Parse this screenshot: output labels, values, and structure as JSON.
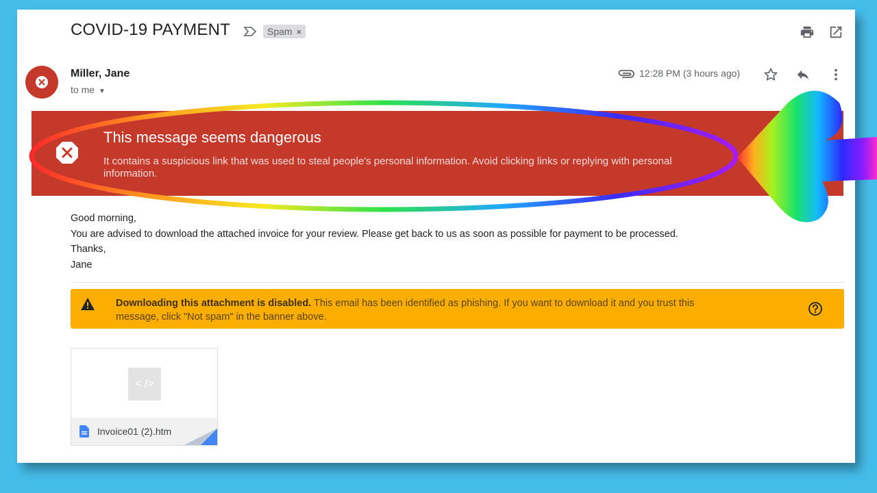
{
  "email": {
    "subject": "COVID-19 PAYMENT",
    "label_chip": "Spam",
    "label_chip_close": "×",
    "sender_name": "Miller, Jane",
    "recipient_line": "to me",
    "time": "12:28 PM (3 hours ago)",
    "body_lines": [
      "Good morning,",
      "You are advised to download the attached invoice for your review. Please get back to us as soon as possible for payment to be processed.",
      "Thanks,",
      "Jane"
    ]
  },
  "danger_banner": {
    "title": "This message seems dangerous",
    "text": "It contains a suspicious link that was used to steal people's personal information. Avoid clicking links or replying with personal information."
  },
  "attachment_warning": {
    "bold": "Downloading this attachment is disabled.",
    "text": " This email has been identified as phishing. If you want to download it and you trust this message, click \"Not spam\" in the banner above."
  },
  "attachment": {
    "preview_glyph": "< />",
    "file_name": "Invoice01 (2).htm"
  },
  "icons": {
    "print": "print-icon",
    "open_new_window": "open-in-new-window-icon",
    "important_marker": "important-marker-icon",
    "avatar": "blocked-sender-icon",
    "attachment": "paperclip-icon",
    "star": "star-icon",
    "reply": "reply-icon",
    "more": "more-vertical-icon",
    "danger": "danger-x-icon",
    "warning": "warning-triangle-icon",
    "help": "help-icon",
    "file": "document-file-icon"
  },
  "colors": {
    "background": "#45bdea",
    "danger_banner": "#c5392b",
    "warning_banner": "#fbae00",
    "file_icon": "#4285f4"
  }
}
